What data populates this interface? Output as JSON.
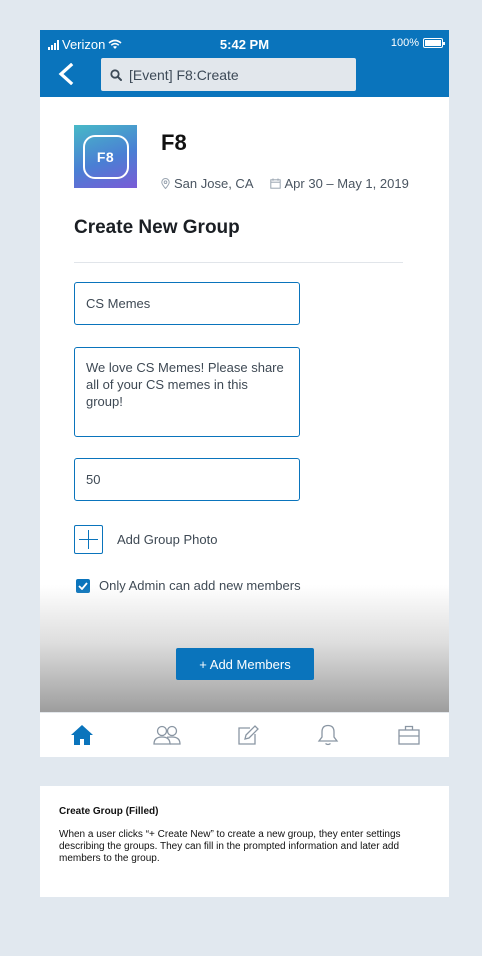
{
  "status_bar": {
    "carrier": "Verizon",
    "time": "5:42 PM",
    "battery": "100%"
  },
  "header": {
    "search_text": "[Event] F8:Create",
    "back_icon": "chevron-left-icon",
    "search_icon": "search-icon"
  },
  "event": {
    "logo_text": "F8",
    "title": "F8",
    "location": "San Jose, CA",
    "dates": "Apr 30 – May 1, 2019",
    "location_icon": "pin-icon",
    "date_icon": "calendar-icon"
  },
  "form": {
    "section_title": "Create New Group",
    "group_name": "CS Memes",
    "description": "We love CS Memes! Please share\nall of your CS memes in this group!",
    "capacity": "50",
    "add_photo_label": "Add Group Photo",
    "admin_only_label": "Only Admin can add new members",
    "admin_only_checked": true,
    "add_members_label": "+ Add Members"
  },
  "tabbar": {
    "items": [
      {
        "name": "home",
        "icon": "home-icon",
        "active": true
      },
      {
        "name": "groups",
        "icon": "people-icon",
        "active": false
      },
      {
        "name": "compose",
        "icon": "edit-icon",
        "active": false
      },
      {
        "name": "notifications",
        "icon": "bell-icon",
        "active": false
      },
      {
        "name": "jobs",
        "icon": "briefcase-icon",
        "active": false
      }
    ]
  },
  "caption": {
    "title": "Create Group (Filled)",
    "body": "When a user clicks “+ Create New” to create a new group, they enter settings describing the groups. They can fill in the prompted information and later add members to the group."
  },
  "colors": {
    "accent": "#0a74bc",
    "background": "#e1e8ef",
    "tab_inactive": "#8a96a3"
  }
}
